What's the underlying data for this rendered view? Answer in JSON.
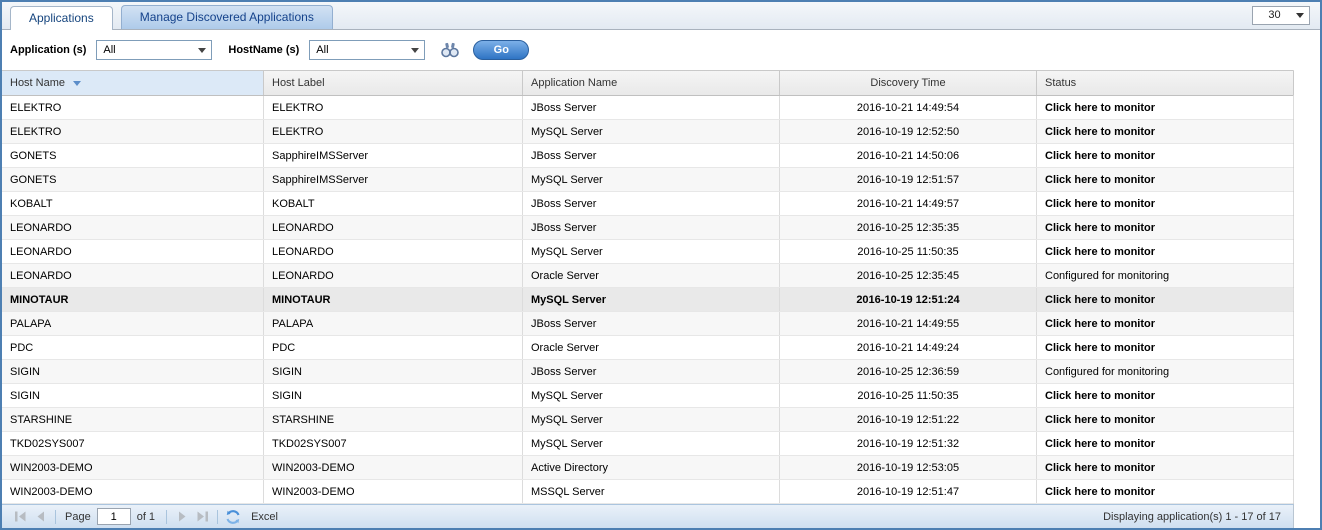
{
  "page_size_value": "30",
  "tabs": [
    {
      "label": "Applications",
      "active": true
    },
    {
      "label": "Manage Discovered Applications",
      "active": false
    }
  ],
  "filters": {
    "application_label": "Application (s)",
    "application_value": "All",
    "hostname_label": "HostName (s)",
    "hostname_value": "All",
    "go_label": "Go"
  },
  "icons": {
    "advanced_search": "binoculars-icon",
    "sort_indicator": "sort-desc-arrow ▼",
    "dropdown": "chevron-down ▼",
    "first_page": "|◀",
    "prev_page": "◀",
    "next_page": "▶",
    "last_page": "▶|",
    "refresh": "⟳ blue circular arrows"
  },
  "colors": {
    "outer_border": "#4d7fb2",
    "tab_inactive_bg": "#b9d1ec",
    "sorted_header_bg": "#dce9f7",
    "go_button": "#2f74c4",
    "highlight_row_bg": "#e9e9e9",
    "footer_bg": "#d9e6f3"
  },
  "table": {
    "sorted_column": "Host Name",
    "sort_direction": "desc",
    "columns": [
      "Host Name",
      "Host Label",
      "Application Name",
      "Discovery Time",
      "Status"
    ],
    "rows": [
      {
        "host_name": "ELEKTRO",
        "host_label": "ELEKTRO",
        "application_name": "JBoss Server",
        "discovery_time": "2016-10-21 14:49:54",
        "status": "Click here to monitor",
        "status_type": "link",
        "highlighted": false
      },
      {
        "host_name": "ELEKTRO",
        "host_label": "ELEKTRO",
        "application_name": "MySQL Server",
        "discovery_time": "2016-10-19 12:52:50",
        "status": "Click here to monitor",
        "status_type": "link",
        "highlighted": false
      },
      {
        "host_name": "GONETS",
        "host_label": "SapphireIMSServer",
        "application_name": "JBoss Server",
        "discovery_time": "2016-10-21 14:50:06",
        "status": "Click here to monitor",
        "status_type": "link",
        "highlighted": false
      },
      {
        "host_name": "GONETS",
        "host_label": "SapphireIMSServer",
        "application_name": "MySQL Server",
        "discovery_time": "2016-10-19 12:51:57",
        "status": "Click here to monitor",
        "status_type": "link",
        "highlighted": false
      },
      {
        "host_name": "KOBALT",
        "host_label": "KOBALT",
        "application_name": "JBoss Server",
        "discovery_time": "2016-10-21 14:49:57",
        "status": "Click here to monitor",
        "status_type": "link",
        "highlighted": false
      },
      {
        "host_name": "LEONARDO",
        "host_label": "LEONARDO",
        "application_name": "JBoss Server",
        "discovery_time": "2016-10-25 12:35:35",
        "status": "Click here to monitor",
        "status_type": "link",
        "highlighted": false
      },
      {
        "host_name": "LEONARDO",
        "host_label": "LEONARDO",
        "application_name": "MySQL Server",
        "discovery_time": "2016-10-25 11:50:35",
        "status": "Click here to monitor",
        "status_type": "link",
        "highlighted": false
      },
      {
        "host_name": "LEONARDO",
        "host_label": "LEONARDO",
        "application_name": "Oracle Server",
        "discovery_time": "2016-10-25 12:35:45",
        "status": "Configured for monitoring",
        "status_type": "text",
        "highlighted": false
      },
      {
        "host_name": "MINOTAUR",
        "host_label": "MINOTAUR",
        "application_name": "MySQL Server",
        "discovery_time": "2016-10-19 12:51:24",
        "status": "Click here to monitor",
        "status_type": "link",
        "highlighted": true
      },
      {
        "host_name": "PALAPA",
        "host_label": "PALAPA",
        "application_name": "JBoss Server",
        "discovery_time": "2016-10-21 14:49:55",
        "status": "Click here to monitor",
        "status_type": "link",
        "highlighted": false
      },
      {
        "host_name": "PDC",
        "host_label": "PDC",
        "application_name": "Oracle Server",
        "discovery_time": "2016-10-21 14:49:24",
        "status": "Click here to monitor",
        "status_type": "link",
        "highlighted": false
      },
      {
        "host_name": "SIGIN",
        "host_label": "SIGIN",
        "application_name": "JBoss Server",
        "discovery_time": "2016-10-25 12:36:59",
        "status": "Configured for monitoring",
        "status_type": "text",
        "highlighted": false
      },
      {
        "host_name": "SIGIN",
        "host_label": "SIGIN",
        "application_name": "MySQL Server",
        "discovery_time": "2016-10-25 11:50:35",
        "status": "Click here to monitor",
        "status_type": "link",
        "highlighted": false
      },
      {
        "host_name": "STARSHINE",
        "host_label": "STARSHINE",
        "application_name": "MySQL Server",
        "discovery_time": "2016-10-19 12:51:22",
        "status": "Click here to monitor",
        "status_type": "link",
        "highlighted": false
      },
      {
        "host_name": "TKD02SYS007",
        "host_label": "TKD02SYS007",
        "application_name": "MySQL Server",
        "discovery_time": "2016-10-19 12:51:32",
        "status": "Click here to monitor",
        "status_type": "link",
        "highlighted": false
      },
      {
        "host_name": "WIN2003-DEMO",
        "host_label": "WIN2003-DEMO",
        "application_name": "Active Directory",
        "discovery_time": "2016-10-19 12:53:05",
        "status": "Click here to monitor",
        "status_type": "link",
        "highlighted": false
      },
      {
        "host_name": "WIN2003-DEMO",
        "host_label": "WIN2003-DEMO",
        "application_name": "MSSQL Server",
        "discovery_time": "2016-10-19 12:51:47",
        "status": "Click here to monitor",
        "status_type": "link",
        "highlighted": false
      }
    ]
  },
  "footer": {
    "page_label": "Page",
    "page_value": "1",
    "of_label": "of 1",
    "excel_label": "Excel",
    "displaying_text": "Displaying application(s) 1 - 17 of 17"
  }
}
